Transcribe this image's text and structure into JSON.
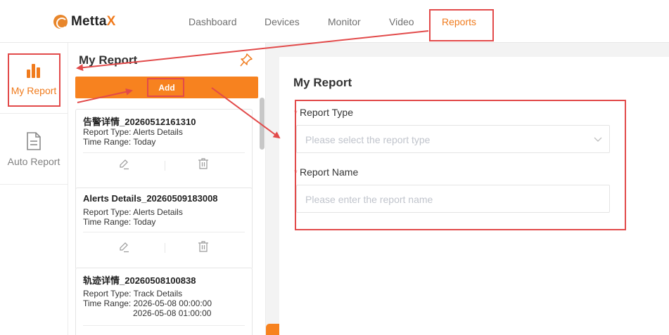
{
  "brand": {
    "name_main": "Metta",
    "name_accent": "X"
  },
  "nav": {
    "items": [
      {
        "label": "Dashboard",
        "active": false
      },
      {
        "label": "Devices",
        "active": false
      },
      {
        "label": "Monitor",
        "active": false
      },
      {
        "label": "Video",
        "active": false
      },
      {
        "label": "Reports",
        "active": true
      }
    ]
  },
  "sidebar": {
    "items": [
      {
        "label": "My Report",
        "icon": "bar-chart-icon",
        "active": true
      },
      {
        "label": "Auto Report",
        "icon": "document-icon",
        "active": false
      }
    ]
  },
  "list_panel": {
    "title": "My Report",
    "add_label": "Add",
    "reports": [
      {
        "name": "告警详情_20260512161310",
        "type_label": "Report Type:",
        "type": "Alerts Details",
        "range_label": "Time Range:",
        "range": "Today",
        "range_end": ""
      },
      {
        "name": "Alerts Details_20260509183008",
        "type_label": "Report Type:",
        "type": "Alerts Details",
        "range_label": "Time Range:",
        "range": "Today",
        "range_end": ""
      },
      {
        "name": "轨迹详情_20260508100838",
        "type_label": "Report Type:",
        "type": "Track Details",
        "range_label": "Time Range:",
        "range": "2026-05-08 00:00:00",
        "range_end": "2026-05-08 01:00:00"
      }
    ]
  },
  "form": {
    "title": "My Report",
    "report_type_label": "Report Type",
    "report_type_placeholder": "Please select the report type",
    "report_name_label": "Report Name",
    "report_name_placeholder": "Please enter the report name",
    "required_mark": "*"
  },
  "colors": {
    "accent": "#f7821f",
    "annotation": "#e24a4a"
  }
}
